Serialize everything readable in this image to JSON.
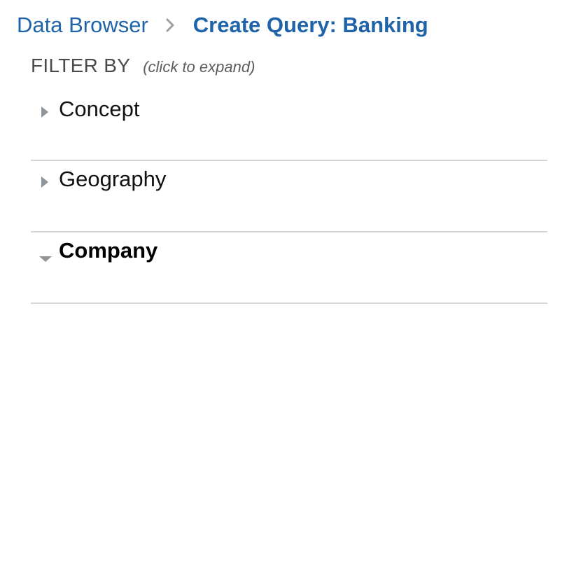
{
  "breadcrumb": {
    "parent_label": "Data Browser",
    "current_label": "Create Query: Banking"
  },
  "filter": {
    "title": "FILTER BY",
    "hint": "(click to expand)",
    "items": [
      {
        "label": "Concept",
        "expanded": false,
        "icon": "triangle-right-icon"
      },
      {
        "label": "Geography",
        "expanded": false,
        "icon": "triangle-right-icon"
      },
      {
        "label": "Company",
        "expanded": true,
        "icon": "triangle-down-icon"
      }
    ]
  },
  "colors": {
    "link_blue": "#1f63a8",
    "separator_gray": "#9aa0a6",
    "divider": "#d5d7d9",
    "toggle_gray": "#8e959b"
  }
}
